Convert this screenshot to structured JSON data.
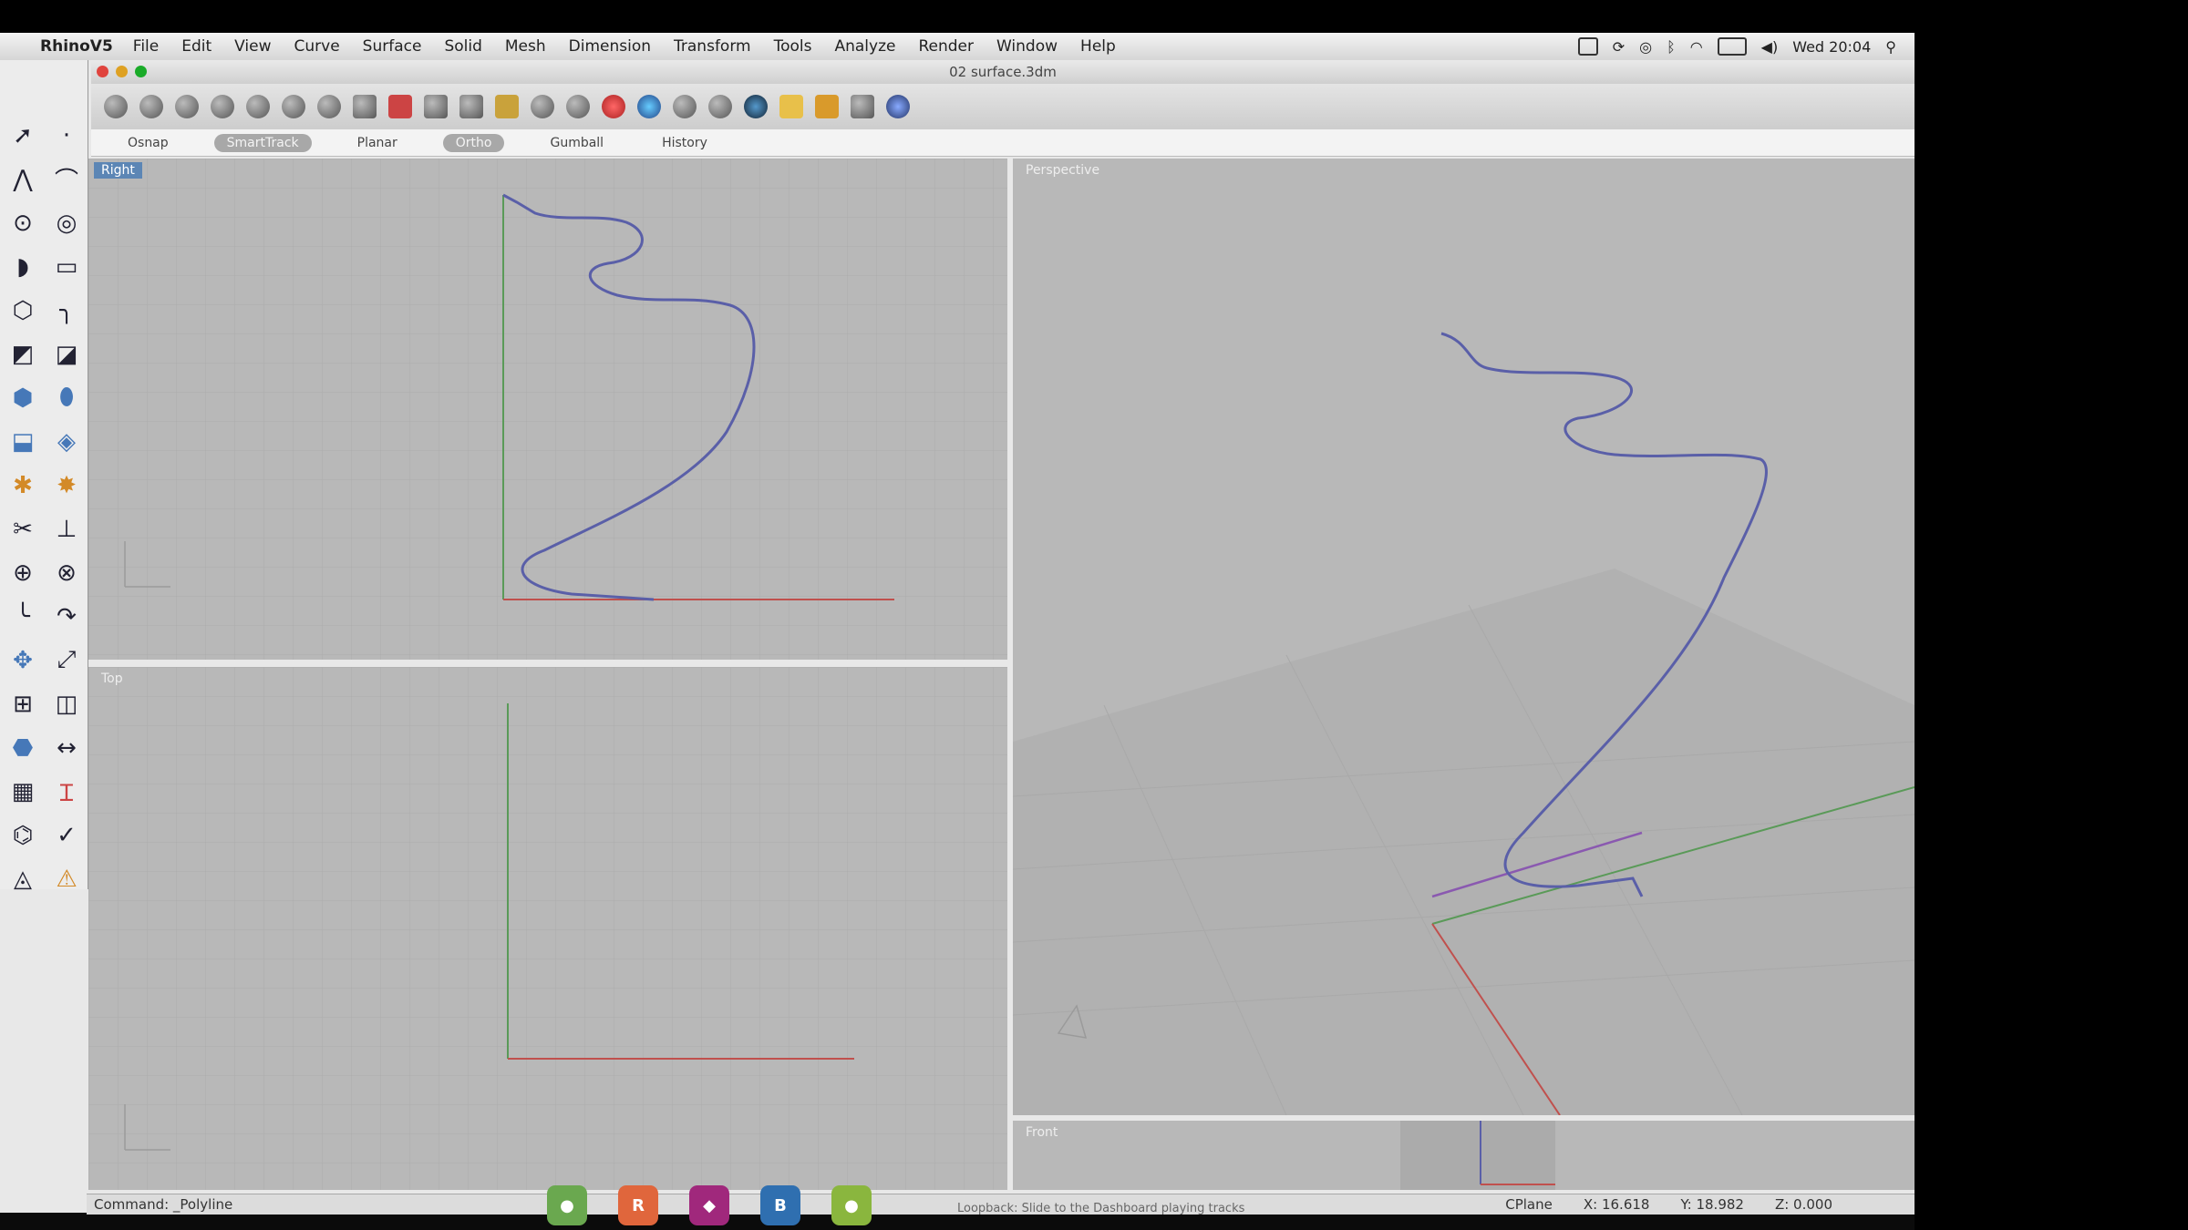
{
  "menubar": {
    "app": "RhinoV5",
    "items": [
      "File",
      "Edit",
      "View",
      "Curve",
      "Surface",
      "Solid",
      "Mesh",
      "Dimension",
      "Transform",
      "Tools",
      "Analyze",
      "Render",
      "Window",
      "Help"
    ],
    "clock": "Wed 20:04"
  },
  "window": {
    "title": "02 surface.3dm"
  },
  "modes": [
    {
      "label": "Osnap",
      "active": false
    },
    {
      "label": "SmartTrack",
      "active": true
    },
    {
      "label": "Planar",
      "active": false
    },
    {
      "label": "Ortho",
      "active": true
    },
    {
      "label": "Gumball",
      "active": false
    },
    {
      "label": "History",
      "active": false
    }
  ],
  "viewports": {
    "right": "Right",
    "top": "Top",
    "perspective": "Perspective",
    "front": "Front"
  },
  "status": {
    "command": "Command: _Polyline",
    "cplane": "CPlane",
    "x": "X: 16.618",
    "y": "Y: 18.982",
    "z": "Z: 0.000"
  },
  "dock_hint": "Loopback: Slide to the Dashboard playing tracks",
  "colors": {
    "curve": "#5a5fa8",
    "x_axis": "#c0504d",
    "y_axis": "#5a9a58",
    "viewport_bg": "#b8b8b8",
    "active_label": "#5c86b5"
  }
}
